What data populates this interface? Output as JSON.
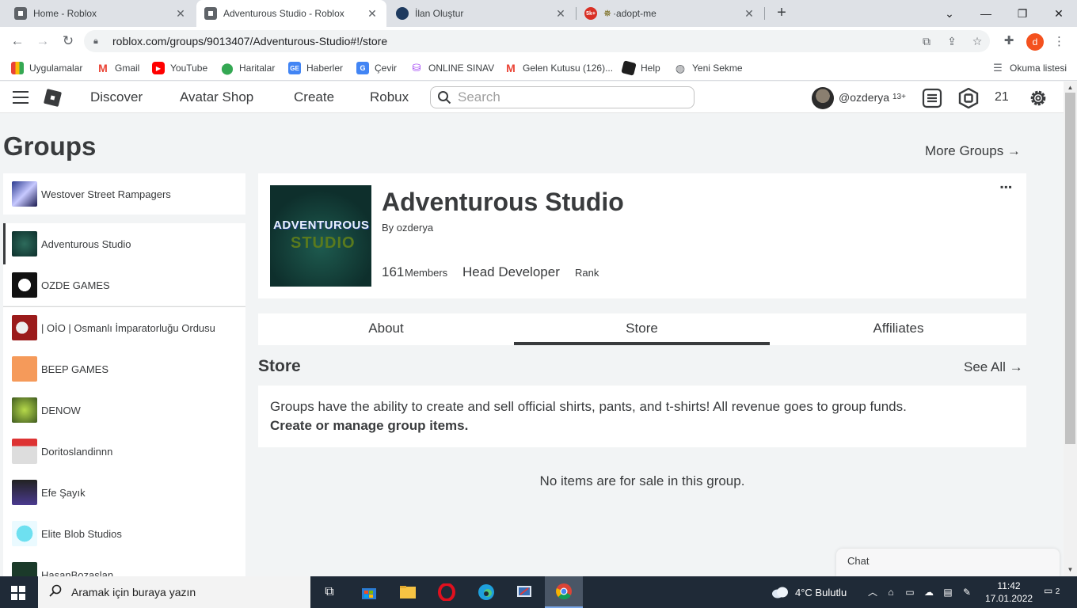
{
  "browser": {
    "tabs": [
      {
        "title": "Home - Roblox",
        "active": false
      },
      {
        "title": "Adventurous Studio - Roblox",
        "active": true
      },
      {
        "title": "İlan Oluştur",
        "active": false
      },
      {
        "title": "·adopt-me",
        "active": false,
        "badge": "5k+"
      }
    ],
    "url": "roblox.com/groups/9013407/Adventurous-Studio#!/store",
    "profile_initial": "d",
    "bookmarks": [
      {
        "label": "Uygulamalar",
        "icon": "apps-grid-icon"
      },
      {
        "label": "Gmail",
        "icon": "gmail-icon"
      },
      {
        "label": "YouTube",
        "icon": "youtube-icon"
      },
      {
        "label": "Haritalar",
        "icon": "maps-pin-icon"
      },
      {
        "label": "Haberler",
        "icon": "news-icon"
      },
      {
        "label": "Çevir",
        "icon": "translate-icon"
      },
      {
        "label": "ONLINE SINAV",
        "icon": "exam-icon"
      },
      {
        "label": "Gelen Kutusu (126)...",
        "icon": "gmail-icon"
      },
      {
        "label": "Help",
        "icon": "help-icon"
      },
      {
        "label": "Yeni Sekme",
        "icon": "globe-icon"
      }
    ],
    "reading_list": "Okuma listesi"
  },
  "roblox_nav": {
    "links": [
      "Discover",
      "Avatar Shop",
      "Create",
      "Robux"
    ],
    "search_placeholder": "Search",
    "username": "@ozderya",
    "age": "13+",
    "robux": "21"
  },
  "page": {
    "title": "Groups",
    "more_groups": "More Groups →"
  },
  "sidebar": {
    "groups": [
      {
        "name": "Westover Street Rampagers"
      },
      {
        "name": "Adventurous Studio",
        "selected": true
      },
      {
        "name": "OZDE GAMES"
      },
      {
        "name": "| OİO | Osmanlı İmparatorluğu Ordusu"
      },
      {
        "name": "BEEP GAMES"
      },
      {
        "name": "DENOW"
      },
      {
        "name": "Doritoslandinnn"
      },
      {
        "name": "Efe Şayık"
      },
      {
        "name": "Elite Blob Studios"
      },
      {
        "name": "HasanBozaslan"
      }
    ]
  },
  "group": {
    "name": "Adventurous Studio",
    "by_prefix": "By",
    "owner": "ozderya",
    "members_count": "161",
    "members_label": "Members",
    "rank_name": "Head Developer",
    "rank_label": "Rank",
    "emblem_line1": "ADVENTUROUS",
    "emblem_line2": "STUDIO",
    "more": "▪▪▪"
  },
  "group_tabs": [
    {
      "label": "About",
      "active": false
    },
    {
      "label": "Store",
      "active": true
    },
    {
      "label": "Affiliates",
      "active": false
    }
  ],
  "store": {
    "heading": "Store",
    "see_all": "See All →",
    "description": "Groups have the ability to create and sell official shirts, pants, and t-shirts! All revenue goes to group funds.",
    "manage_link": "Create or manage group items.",
    "empty_message": "No items are for sale in this group."
  },
  "chat": {
    "label": "Chat"
  },
  "taskbar": {
    "search_placeholder": "Aramak için buraya yazın",
    "weather": "4°C  Bulutlu",
    "time": "11:42",
    "date": "17.01.2022",
    "notifications": "2"
  }
}
